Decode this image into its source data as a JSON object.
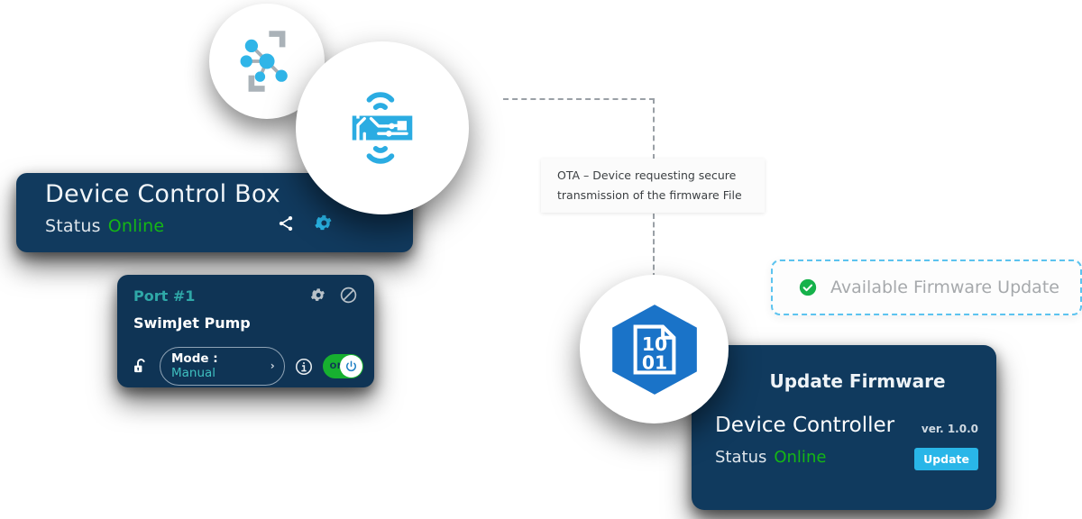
{
  "colors": {
    "card_navy": "#113a5e",
    "port_navy": "#0f3455",
    "accent_cyan": "#29b6e8",
    "teal": "#2fa8a8",
    "status_green": "#15b715",
    "toggle_green": "#17b030",
    "dashed_blue": "#5cc3ef",
    "hex_blue": "#1a73c8",
    "node_blue": "#30b5e8",
    "gray_icon": "#aab2b8"
  },
  "control_card": {
    "title": "Device Control Box",
    "status_label": "Status",
    "status_value": "Online",
    "icons": [
      "share-icon",
      "gear-icon"
    ]
  },
  "port_card": {
    "port_label": "Port #1",
    "device_name": "SwimJet Pump",
    "icons": [
      "gear-icon",
      "block-icon"
    ],
    "lock_icon": "unlock-icon",
    "mode": {
      "key": "Mode :",
      "value": "Manual",
      "chevron": "›"
    },
    "info_icon": "info-icon",
    "toggle": {
      "state_label": "ON",
      "knob_icon": "power-icon"
    }
  },
  "ota_tooltip": {
    "line1": "OTA – Device requesting secure",
    "line2": "transmission of the firmware File"
  },
  "available_pill": {
    "check_icon": "check-circle-icon",
    "text": "Available Firmware Update"
  },
  "firmware_card": {
    "title": "Update Firmware",
    "device_name": "Device Controller",
    "version": "ver. 1.0.0",
    "status_label": "Status",
    "status_value": "Online",
    "update_button": "Update"
  },
  "badges": {
    "network_icon": "network-nodes-icon",
    "board_icon": "wireless-circuit-board-icon",
    "binary_icon": "binary-file-hexagon-icon",
    "binary_top_digits": "10",
    "binary_bottom_digits": "01"
  }
}
